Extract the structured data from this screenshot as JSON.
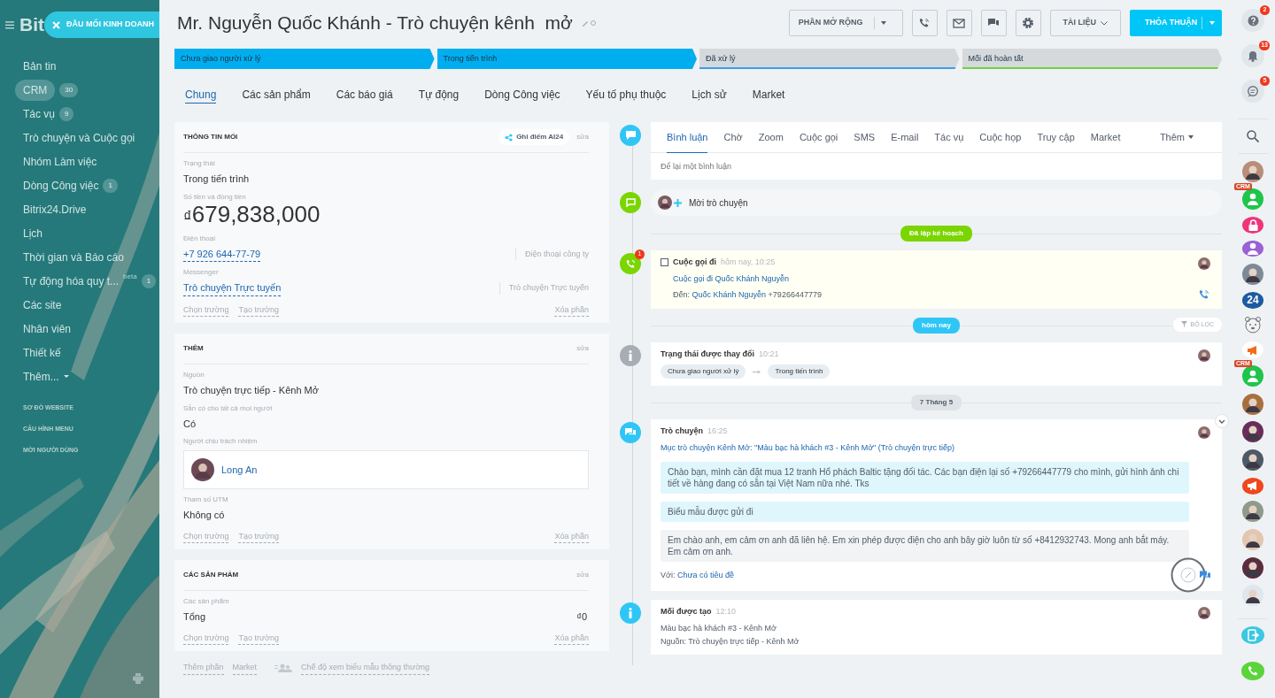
{
  "sidebar": {
    "logo": "Bit",
    "pinned_button": "ĐẦU MỐI KINH DOANH",
    "items": [
      {
        "label": "Bản tin",
        "selected": false
      },
      {
        "label": "CRM",
        "count": "30",
        "selected": true
      },
      {
        "label": "Tác vụ",
        "count": "9",
        "selected": false
      },
      {
        "label": "Trò chuyện và Cuộc gọi",
        "selected": false
      },
      {
        "label": "Nhóm Làm việc",
        "selected": false
      },
      {
        "label": "Dòng Công việc",
        "count": "1",
        "selected": false
      },
      {
        "label": "Bitrix24.Drive",
        "selected": false
      },
      {
        "label": "Lịch",
        "selected": false
      },
      {
        "label": "Thời gian và Báo cáo",
        "selected": false
      },
      {
        "label": "Tự động hóa quy t...",
        "tag": "beta",
        "count": "1",
        "selected": false
      },
      {
        "label": "Các site",
        "selected": false
      },
      {
        "label": "Nhân viên",
        "selected": false
      },
      {
        "label": "Thiết kế",
        "selected": false
      },
      {
        "label": "Thêm...",
        "dropdown": true,
        "selected": false
      }
    ],
    "links": [
      "SƠ ĐỒ WEBSITE",
      "CẤU HÌNH MENU",
      "MỜI NGƯỜI DÙNG"
    ]
  },
  "header": {
    "title": "Mr. Nguyễn Quốc Khánh - Trò chuyện kênh  mở",
    "buttons": [
      {
        "kind": "split",
        "label": "PHẦN MỞ RỘNG"
      },
      {
        "kind": "call"
      },
      {
        "kind": "mail"
      },
      {
        "kind": "chat"
      },
      {
        "kind": "settings"
      },
      {
        "kind": "dropdown",
        "label": "TÀI LIỆU"
      },
      {
        "kind": "primary",
        "label": "THỎA THUẬN"
      }
    ]
  },
  "stages": [
    {
      "label": "Chưa giao người xử lý",
      "passed": true,
      "color": "#00aeef"
    },
    {
      "label": "Trong tiến trình",
      "passed": true,
      "color": "#00aeef"
    },
    {
      "label": "Đã xử lý",
      "passed": false,
      "color": "#3a9ee8"
    },
    {
      "label": "Mối đã hoàn tất",
      "passed": false,
      "color": "#6bd53a"
    }
  ],
  "tabs": [
    {
      "label": "Chung",
      "selected": true
    },
    {
      "label": "Các sản phẩm",
      "selected": false
    },
    {
      "label": "Các báo giá",
      "selected": false
    },
    {
      "label": "Tự động",
      "selected": false
    },
    {
      "label": "Dòng Công việc",
      "selected": false
    },
    {
      "label": "Yếu tố phụ thuộc",
      "selected": false
    },
    {
      "label": "Lịch sử",
      "selected": false
    },
    {
      "label": "Market",
      "selected": false
    }
  ],
  "sections": [
    {
      "title": "THÔNG TIN MỐI",
      "score_button": "Ghi điểm AI24",
      "edit": "sửa",
      "fields": [
        {
          "kind": "text",
          "label": "Trạng thái",
          "value": "Trong tiến trình"
        },
        {
          "kind": "amount",
          "label": "Số tiền và đồng tiền",
          "currency": "₫",
          "value": "679,838,000"
        },
        {
          "kind": "link",
          "label": "Điện thoại",
          "value": "+7 926 644-77-79",
          "side": "Điện thoại công ty"
        },
        {
          "kind": "link",
          "label": "Messenger",
          "value": "Trò chuyện Trực tuyến",
          "side": "Trò chuyện Trực tuyến"
        }
      ],
      "actions": [
        "Chọn trường",
        "Tạo trường"
      ],
      "remove": "Xóa phần"
    },
    {
      "title": "THÊM",
      "edit": "sửa",
      "fields": [
        {
          "kind": "text",
          "label": "Nguồn",
          "value": "Trò chuyện trực tiếp - Kênh Mở"
        },
        {
          "kind": "text",
          "label": "Sẵn có cho tất cả mọi người",
          "value": "Có"
        },
        {
          "kind": "user",
          "label": "Người chịu trách nhiệm",
          "value": "Long An"
        },
        {
          "kind": "text",
          "label": "Tham số UTM",
          "value": "Không có"
        }
      ],
      "actions": [
        "Chọn trường",
        "Tạo trường"
      ],
      "remove": "Xóa phần"
    },
    {
      "title": "CÁC SẢN PHẨM",
      "edit": "sửa",
      "fields": [
        {
          "kind": "total",
          "label": "Các sản phẩm",
          "value": "Tổng",
          "amount": "₫0"
        }
      ],
      "actions": [
        "Chọn trường",
        "Tạo trường"
      ],
      "remove": "Xóa phần"
    }
  ],
  "section_footer": {
    "links": [
      "Thêm phần",
      "Market"
    ],
    "mode": "Chế độ xem biểu mẫu thông thường"
  },
  "timeline": {
    "editor": {
      "tabs": [
        {
          "label": "Bình luận",
          "selected": true
        },
        {
          "label": "Chờ",
          "selected": false
        },
        {
          "label": "Zoom",
          "selected": false
        },
        {
          "label": "Cuộc gọi",
          "selected": false
        },
        {
          "label": "SMS",
          "selected": false
        },
        {
          "label": "E-mail",
          "selected": false
        },
        {
          "label": "Tác vụ",
          "selected": false
        },
        {
          "label": "Cuộc họp",
          "selected": false
        },
        {
          "label": "Truy cập",
          "selected": false
        },
        {
          "label": "Market",
          "selected": false
        }
      ],
      "more": "Thêm",
      "placeholder": "Để lại một bình luận"
    },
    "invite": "Mời trò chuyện",
    "entries": [
      {
        "kind": "divider",
        "label": "Đã lập kế hoạch",
        "color": "#7bd500"
      },
      {
        "kind": "call",
        "badge": "1",
        "checked": false,
        "title": "Cuộc gọi đi",
        "time": "hôm nay, 10:25",
        "link": "Cuộc gọi đi Quốc Khánh Nguyễn",
        "to_label": "Đến:",
        "to_name": "Quốc Khánh Nguyễn",
        "to_number": "+79266447779"
      },
      {
        "kind": "divider",
        "label": "hôm nay",
        "color": "#2fc6f6",
        "filter": "BỘ LỌC"
      },
      {
        "kind": "status",
        "title": "Trạng thái được thay đổi",
        "time": "10:21",
        "from": "Chưa giao người xử lý",
        "to": "Trong tiến trình"
      },
      {
        "kind": "divider",
        "label": "7 Tháng 5",
        "color": "#dfe3e6"
      },
      {
        "kind": "chat",
        "title": "Trò chuyện",
        "time": "16:25",
        "link": "Mục trò chuyện Kênh Mở: \"Màu bạc hà khách #3 - Kênh Mở\" (Trò chuyện trực tiếp)",
        "messages": [
          {
            "kind": "incoming",
            "text": "Chào bạn, mình cần đặt mua 12 tranh Hổ phách Baltic tặng đối tác. Các bạn điện lại số +79266447779 cho mình, gửi hình ảnh chi tiết về hàng đang có sẵn tại Việt Nam nữa nhé. Tks"
          },
          {
            "kind": "incoming",
            "text": "Biểu mẫu được gửi đi"
          },
          {
            "kind": "outgoing",
            "text": "Em chào anh, em cảm ơn anh đã liên hệ. Em xin phép được điện cho anh bây giờ luôn từ số +8412932743. Mong anh bắt máy. Em cảm ơn anh."
          }
        ],
        "with_label": "Với:",
        "with_link": "Chưa có tiêu đề"
      },
      {
        "kind": "created",
        "title": "Mối được tạo",
        "time": "12:10",
        "lines": [
          "Màu bạc hà khách #3 - Kênh Mở",
          "Nguồn: Trò chuyện trực tiếp - Kênh Mở"
        ]
      }
    ]
  },
  "right_bar": {
    "tools": [
      {
        "kind": "help",
        "badge": "2"
      },
      {
        "kind": "bell",
        "badge": "13"
      },
      {
        "kind": "chat",
        "badge": "5"
      },
      {
        "kind": "search"
      }
    ],
    "contacts": [
      {
        "kind": "person",
        "color": "#b98d7a"
      },
      {
        "kind": "user",
        "color": "#1fc54a",
        "tag": "CRM"
      },
      {
        "kind": "lock",
        "color": "#f0347a"
      },
      {
        "kind": "user",
        "color": "#9b5fd6"
      },
      {
        "kind": "person",
        "color": "#7d8a96"
      },
      {
        "kind": "text",
        "color": "#1d5aa0",
        "text": "24"
      },
      {
        "kind": "bear",
        "color": "#f2f2f2"
      },
      {
        "kind": "megaphone",
        "color": "#ffffff"
      },
      {
        "kind": "user",
        "color": "#1fc54a",
        "tag": "CRM"
      },
      {
        "kind": "person",
        "color": "#a8703f"
      },
      {
        "kind": "person",
        "color": "#6a2d5a"
      },
      {
        "kind": "person",
        "color": "#4d5a66"
      },
      {
        "kind": "megaphone",
        "color": "#f0471f"
      },
      {
        "kind": "person",
        "color": "#8f9a8a"
      },
      {
        "kind": "person",
        "color": "#e2c6b0"
      },
      {
        "kind": "person",
        "color": "#5a2d3e"
      },
      {
        "kind": "person",
        "color": "#dfe6ee"
      }
    ],
    "bottom": [
      {
        "kind": "exit",
        "color": "#3bc8e0"
      },
      {
        "kind": "phone",
        "color": "#5ad43a"
      }
    ]
  }
}
